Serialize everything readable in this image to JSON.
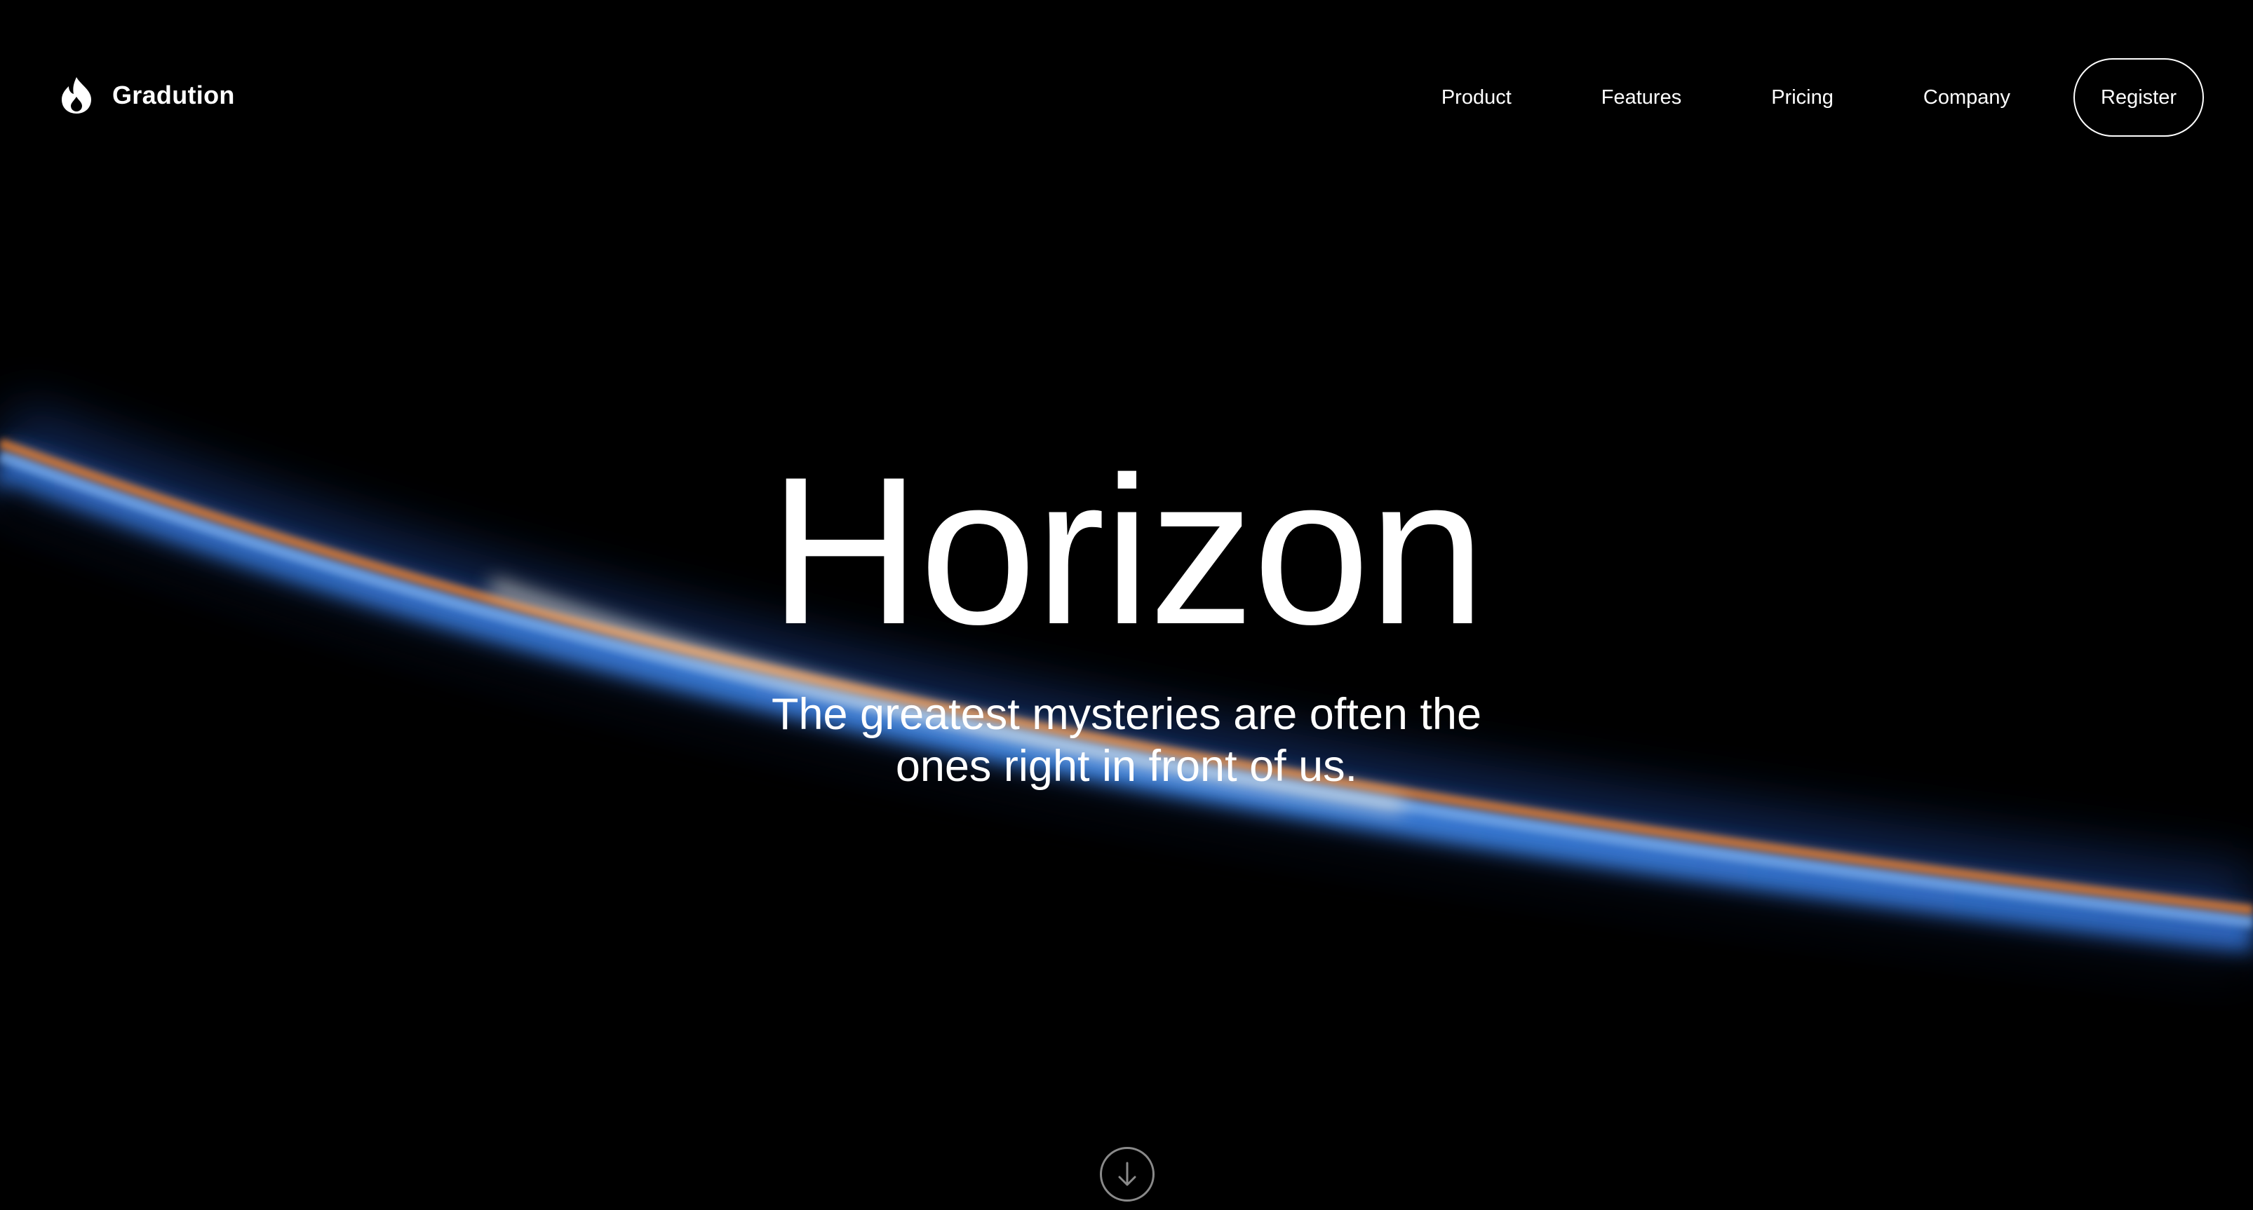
{
  "brand": {
    "name": "Gradution",
    "icon": "flame-icon"
  },
  "nav": {
    "items": [
      {
        "label": "Product"
      },
      {
        "label": "Features"
      },
      {
        "label": "Pricing"
      },
      {
        "label": "Company"
      }
    ],
    "register_label": "Register"
  },
  "hero": {
    "title": "Horizon",
    "subtitle": "The greatest mysteries are often the ones right in front of us."
  },
  "scroll": {
    "icon": "arrow-down-icon"
  },
  "colors": {
    "background": "#000000",
    "text": "#ffffff",
    "atmosphere_blue": "#3a7bd5",
    "atmosphere_orange": "#e0742a"
  }
}
